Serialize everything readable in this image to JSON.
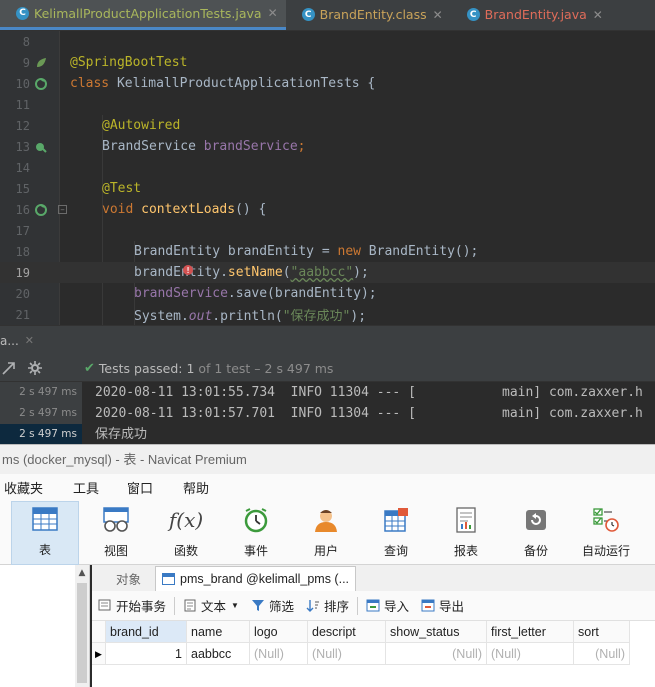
{
  "ide": {
    "tabs": [
      {
        "label": "KelimallProductApplicationTests.java",
        "active": true
      },
      {
        "label": "BrandEntity.class",
        "active": false
      },
      {
        "label": "BrandEntity.java",
        "active": false
      }
    ],
    "line_numbers": [
      "8",
      "9",
      "10",
      "11",
      "12",
      "13",
      "14",
      "15",
      "16",
      "17",
      "18",
      "19",
      "20",
      "21"
    ],
    "code": {
      "l9": "@SpringBootTest",
      "l10_kw": "class",
      "l10_rest": " KelimallProductApplicationTests {",
      "l12": "@Autowired",
      "l13_type": "BrandService ",
      "l13_field": "brandService",
      "l13_end": ";",
      "l15": "@Test",
      "l16_kw": "void",
      "l16_fn": " contextLoads",
      "l16_rest": "() {",
      "l18_a": "BrandEntity brandEntity = ",
      "l18_kw": "new",
      "l18_b": " BrandEntity();",
      "l19_a": "brandEntity.",
      "l19_fn": "setName",
      "l19_b": "(",
      "l19_str": "\"aabbcc\"",
      "l19_c": ");",
      "l20_field": "brandService",
      "l20_rest": ".save(brandEntity);",
      "l21_a": "System.",
      "l21_it": "out",
      "l21_b": ".println(",
      "l21_str": "\"保存成功\"",
      "l21_c": ");"
    }
  },
  "run": {
    "tab_label": "a...",
    "status_prefix": "Tests passed: ",
    "passed_count": "1",
    "status_suffix": " of 1 test – 2 s 497 ms",
    "side_times": [
      "2 s 497 ms",
      "2 s 497 ms",
      "2 s 497 ms"
    ],
    "console_lines": [
      "2020-08-11 13:01:55.734  INFO 11304 --- [           main] com.zaxxer.h",
      "2020-08-11 13:01:57.701  INFO 11304 --- [           main] com.zaxxer.h",
      "保存成功"
    ]
  },
  "navicat": {
    "title": "ms (docker_mysql) - 表 - Navicat Premium",
    "menu": [
      "收藏夹",
      "工具",
      "窗口",
      "帮助"
    ],
    "toolbar": [
      "表",
      "视图",
      "函数",
      "事件",
      "用户",
      "查询",
      "报表",
      "备份",
      "自动运行"
    ],
    "tabs": [
      "对象",
      "pms_brand @kelimall_pms (..."
    ],
    "actions": [
      "开始事务",
      "文本",
      "筛选",
      "排序",
      "导入",
      "导出"
    ],
    "columns": [
      "brand_id",
      "name",
      "logo",
      "descript",
      "show_status",
      "first_letter",
      "sort"
    ],
    "row": [
      "1",
      "aabbcc",
      "(Null)",
      "(Null)",
      "(Null)",
      "(Null)",
      "(Null)"
    ]
  }
}
